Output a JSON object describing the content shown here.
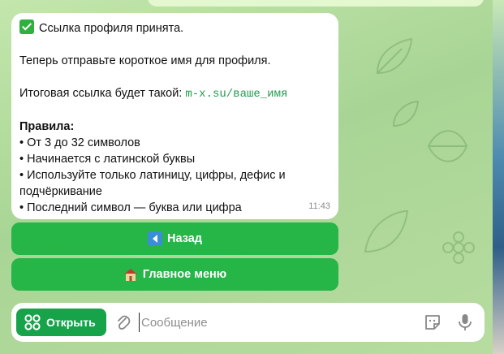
{
  "message": {
    "line1": "Ссылка профиля принята.",
    "line2": "Теперь отправьте короткое имя для профиля.",
    "line3_text": "Итоговая ссылка будет такой: ",
    "line3_link": "m-x.su/ваше_имя",
    "rules_title": "Правила:",
    "rules": [
      "• От 3 до 32 символов",
      "• Начинается с латинской буквы",
      "• Используйте только латиницу, цифры, дефис и",
      "подчёркивание",
      "• Последний символ — буква или цифра"
    ],
    "time": "11:43"
  },
  "keyboard": {
    "back_label": "Назад",
    "menu_label": "Главное меню"
  },
  "composer": {
    "open_label": "Открыть",
    "placeholder": "Сообщение"
  },
  "colors": {
    "accent": "#26b547",
    "open_button": "#17a34a",
    "link": "#239a4f"
  },
  "icons": [
    "check-mark-icon",
    "back-arrow-icon",
    "house-icon",
    "apps-grid-icon",
    "paperclip-icon",
    "sticker-icon",
    "microphone-icon"
  ]
}
